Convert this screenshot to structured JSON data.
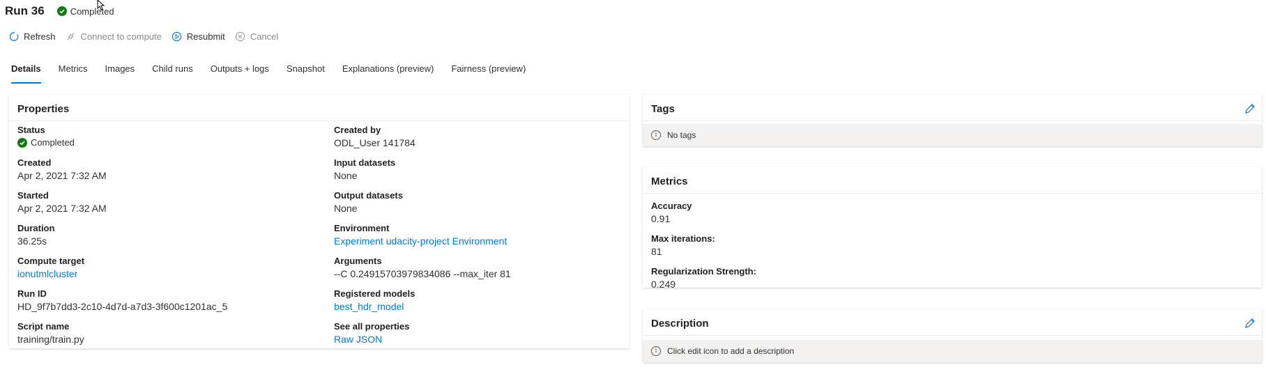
{
  "header": {
    "title": "Run 36",
    "status": "Completed"
  },
  "toolbar": {
    "refresh": "Refresh",
    "connect": "Connect to compute",
    "resubmit": "Resubmit",
    "cancel": "Cancel"
  },
  "tabs": [
    {
      "label": "Details"
    },
    {
      "label": "Metrics"
    },
    {
      "label": "Images"
    },
    {
      "label": "Child runs"
    },
    {
      "label": "Outputs + logs"
    },
    {
      "label": "Snapshot"
    },
    {
      "label": "Explanations (preview)"
    },
    {
      "label": "Fairness (preview)"
    }
  ],
  "properties": {
    "title": "Properties",
    "status_label": "Status",
    "status_value": "Completed",
    "created_label": "Created",
    "created_value": "Apr 2, 2021 7:32 AM",
    "started_label": "Started",
    "started_value": "Apr 2, 2021 7:32 AM",
    "duration_label": "Duration",
    "duration_value": "36.25s",
    "compute_label": "Compute target",
    "compute_value": "ionutmlcluster",
    "runid_label": "Run ID",
    "runid_value": "HD_9f7b7dd3-2c10-4d7d-a7d3-3f600c1201ac_5",
    "script_label": "Script name",
    "script_value": "training/train.py",
    "createdby_label": "Created by",
    "createdby_value": "ODL_User 141784",
    "input_label": "Input datasets",
    "input_value": "None",
    "output_label": "Output datasets",
    "output_value": "None",
    "env_label": "Environment",
    "env_value": "Experiment udacity-project Environment",
    "args_label": "Arguments",
    "args_value": "--C 0.24915703979834086 --max_iter 81",
    "models_label": "Registered models",
    "models_value": "best_hdr_model",
    "all_label": "See all properties",
    "all_value": "Raw JSON"
  },
  "tags": {
    "title": "Tags",
    "empty": "No tags"
  },
  "metrics": {
    "title": "Metrics",
    "items": [
      {
        "label": "Accuracy",
        "value": "0.91"
      },
      {
        "label": "Max iterations:",
        "value": "81"
      },
      {
        "label": "Regularization Strength:",
        "value": "0.249"
      }
    ]
  },
  "description": {
    "title": "Description",
    "empty": "Click edit icon to add a description"
  },
  "colors": {
    "accent": "#0078d4",
    "success": "#107c10",
    "info_bg": "#f3f2f1"
  }
}
